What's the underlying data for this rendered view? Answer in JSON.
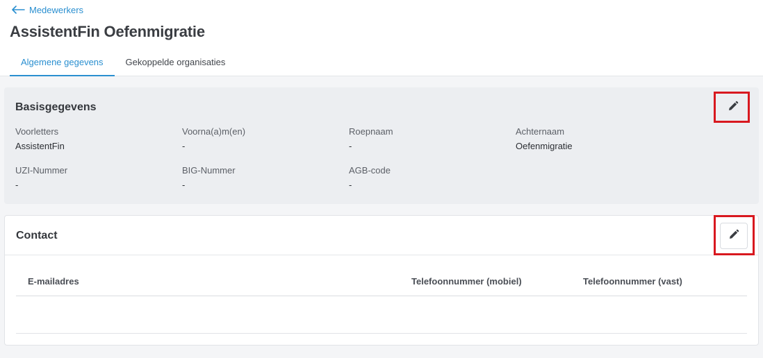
{
  "breadcrumb": {
    "back_label": "Medewerkers"
  },
  "page": {
    "title": "AssistentFin Oefenmigratie"
  },
  "tabs": [
    {
      "label": "Algemene gegevens",
      "active": true
    },
    {
      "label": "Gekoppelde organisaties",
      "active": false
    }
  ],
  "basisgegevens": {
    "title": "Basisgegevens",
    "edit_icon": "pencil-icon",
    "fields": [
      {
        "label": "Voorletters",
        "value": "AssistentFin"
      },
      {
        "label": "Voorna(a)m(en)",
        "value": "-"
      },
      {
        "label": "Roepnaam",
        "value": "-"
      },
      {
        "label": "Achternaam",
        "value": "Oefenmigratie"
      },
      {
        "label": "UZI-Nummer",
        "value": "-"
      },
      {
        "label": "BIG-Nummer",
        "value": "-"
      },
      {
        "label": "AGB-code",
        "value": "-"
      }
    ]
  },
  "contact": {
    "title": "Contact",
    "edit_icon": "pencil-icon",
    "columns": [
      "E-mailadres",
      "Telefoonnummer (mobiel)",
      "Telefoonnummer (vast)"
    ],
    "rows": []
  },
  "colors": {
    "accent": "#2a8fd0",
    "highlight": "#d8181f",
    "card_grey": "#eceef1"
  }
}
